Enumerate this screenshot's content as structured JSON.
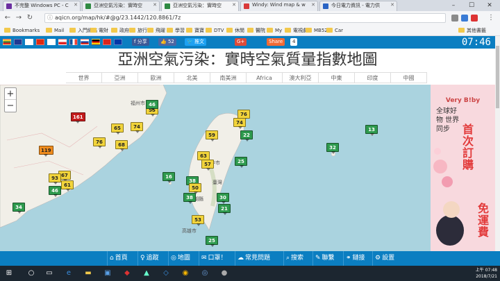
{
  "browser": {
    "tabs": [
      {
        "title": "不完整 Windows PC - C",
        "color": "#6b2fa0"
      },
      {
        "title": "亞洲空氣污染：實時空",
        "color": "#2f8a43"
      },
      {
        "title": "亞洲空氣污染：實時空",
        "color": "#2f8a43"
      },
      {
        "title": "Windy: Wind map & w",
        "color": "#d93a3a"
      },
      {
        "title": "今日電力資訊 - 電力供",
        "color": "#2a64c4"
      }
    ],
    "url": "aqicn.org/map/hk/#@g/23.1442/120.8861/7z",
    "bookmarks": [
      "Bookmarks",
      "Mail",
      "入門網站",
      "電財",
      "政府",
      "旅行",
      "飛躍",
      "學習",
      "寶寶",
      "DTV",
      "休閒",
      "醫院",
      "My",
      "電視劇",
      "MB525",
      "Car",
      "其他書籤"
    ]
  },
  "page": {
    "share_label": "分享",
    "like_count": "52",
    "tweet_label": "推文",
    "gplus_label": "G+",
    "share2_label": "Share",
    "share2_count": "4",
    "clock": "07:46",
    "title": "亞洲空氣污染：實時空氣質量指數地圖",
    "regions": [
      "世界",
      "亞洲",
      "歐洲",
      "北美",
      "南美洲",
      "Africa",
      "澳大利亞",
      "中東",
      "印度",
      "中國"
    ]
  },
  "map": {
    "labels": [
      {
        "text": "福州市",
        "key": "fuzhou"
      },
      {
        "text": "澎湖縣",
        "key": "penghu"
      },
      {
        "text": "臺灣",
        "key": "taiwan"
      },
      {
        "text": "臺中市",
        "key": "taichung"
      },
      {
        "text": "高雄市",
        "key": "kaohsiung"
      }
    ],
    "markers": [
      {
        "value": "161",
        "color": "#c41c1c"
      },
      {
        "value": "55",
        "color": "#f2d43b"
      },
      {
        "value": "46",
        "color": "#2e9a4e"
      },
      {
        "value": "65",
        "color": "#f2d43b"
      },
      {
        "value": "74",
        "color": "#f2d43b"
      },
      {
        "value": "76",
        "color": "#f2d43b"
      },
      {
        "value": "68",
        "color": "#f2d43b"
      },
      {
        "value": "119",
        "color": "#ef8c1e"
      },
      {
        "value": "67",
        "color": "#f2d43b"
      },
      {
        "value": "93",
        "color": "#f2d43b"
      },
      {
        "value": "61",
        "color": "#f2d43b"
      },
      {
        "value": "46",
        "color": "#2e9a4e"
      },
      {
        "value": "34",
        "color": "#2e9a4e"
      },
      {
        "value": "76",
        "color": "#f2d43b"
      },
      {
        "value": "74",
        "color": "#f2d43b"
      },
      {
        "value": "22",
        "color": "#2e9a4e"
      },
      {
        "value": "59",
        "color": "#f2d43b"
      },
      {
        "value": "63",
        "color": "#f2d43b"
      },
      {
        "value": "57",
        "color": "#f2d43b"
      },
      {
        "value": "25",
        "color": "#2e9a4e"
      },
      {
        "value": "16",
        "color": "#2e9a4e"
      },
      {
        "value": "38",
        "color": "#2e9a4e"
      },
      {
        "value": "50",
        "color": "#f2d43b"
      },
      {
        "value": "38",
        "color": "#2e9a4e"
      },
      {
        "value": "30",
        "color": "#2e9a4e"
      },
      {
        "value": "21",
        "color": "#2e9a4e"
      },
      {
        "value": "53",
        "color": "#f2d43b"
      },
      {
        "value": "25",
        "color": "#2e9a4e"
      },
      {
        "value": "32",
        "color": "#2e9a4e"
      },
      {
        "value": "13",
        "color": "#2e9a4e"
      }
    ]
  },
  "ad": {
    "brand": "Very B!by",
    "slogan": "全球好物 世界同步",
    "headline1": "首次訂購",
    "headline2": "免運費"
  },
  "bottom_nav": [
    "首頁",
    "追蹤",
    "地圖",
    "口罩！",
    "常見問題",
    "搜索",
    "聯繫",
    "鏈接",
    "設置"
  ],
  "taskbar": {
    "time": "上午 07:48",
    "date": "2018/7/21"
  }
}
